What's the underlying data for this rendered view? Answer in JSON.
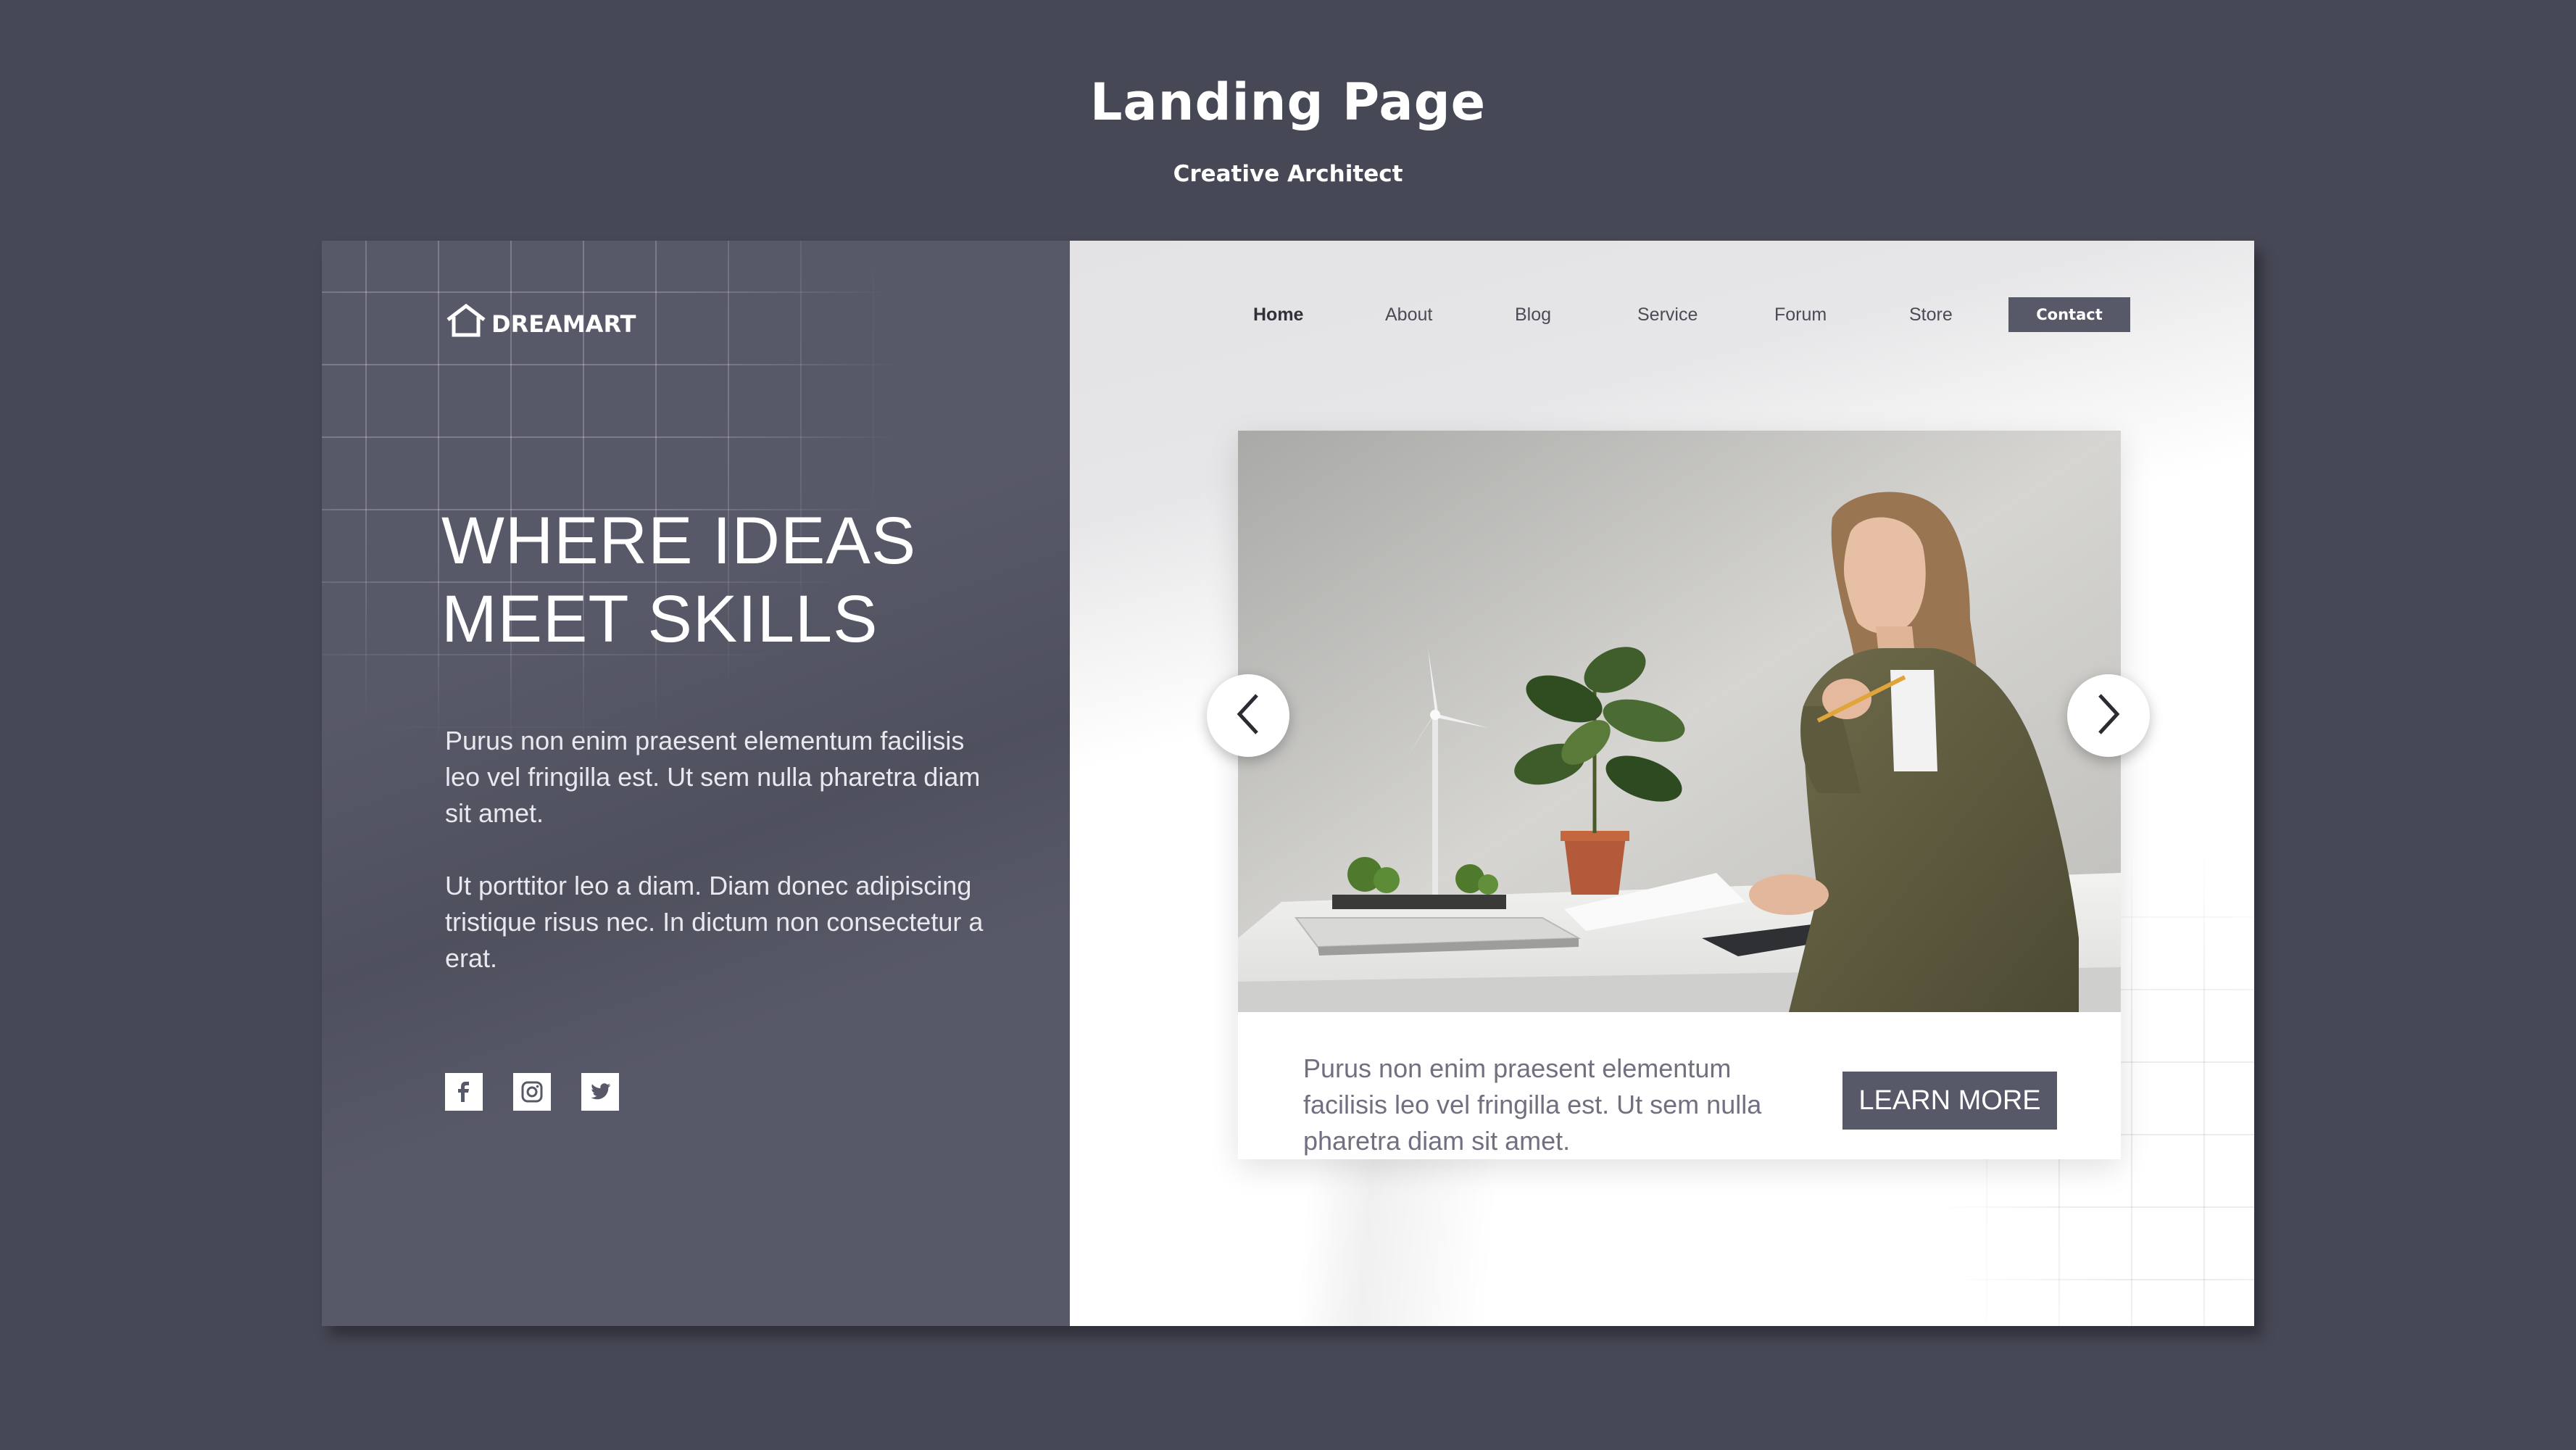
{
  "header": {
    "title": "Landing Page",
    "subtitle": "Creative Architect"
  },
  "brand": {
    "name": "DREAMART",
    "icon": "house-icon"
  },
  "nav": {
    "items": [
      {
        "label": "Home",
        "active": true
      },
      {
        "label": "About",
        "active": false
      },
      {
        "label": "Blog",
        "active": false
      },
      {
        "label": "Service",
        "active": false
      },
      {
        "label": "Forum",
        "active": false
      },
      {
        "label": "Store",
        "active": false
      }
    ],
    "contact_label": "Contact"
  },
  "hero": {
    "heading_line1": "WHERE IDEAS",
    "heading_line2": "MEET SKILLS",
    "paragraph1": "Purus non enim praesent elementum facilisis leo vel fringilla est. Ut sem nulla pharetra diam sit amet.",
    "paragraph2": "Ut porttitor leo a diam. Diam donec adipiscing tristique risus nec. In dictum non consectetur a erat."
  },
  "socials": [
    {
      "name": "facebook-icon",
      "glyph": "f"
    },
    {
      "name": "instagram-icon",
      "glyph": ""
    },
    {
      "name": "twitter-icon",
      "glyph": ""
    }
  ],
  "card": {
    "text": "Purus non enim praesent elementum facilisis leo vel fringilla est. Ut sem nulla pharetra diam sit amet.",
    "button_label": "LEARN MORE"
  },
  "colors": {
    "background": "#474856",
    "panel": "#585968",
    "accent_button": "#585968",
    "white": "#ffffff"
  }
}
